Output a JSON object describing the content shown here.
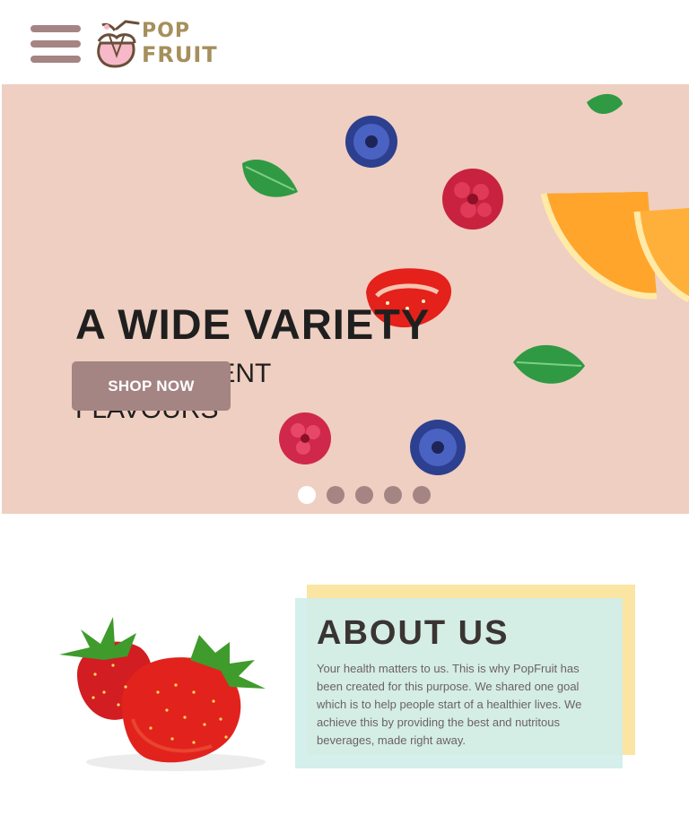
{
  "header": {
    "menu_icon": "hamburger-menu-icon",
    "logo": {
      "line1": "POP",
      "line2": "FRUIT",
      "icon": "apple-cup-logo-icon"
    }
  },
  "hero": {
    "title": "A WIDE VARIETY",
    "subtitle": "OF DIFFERENT\nFLAVOURS",
    "button_label": "SHOP NOW",
    "slides": 5,
    "active_slide": 1
  },
  "about": {
    "title": "ABOUT US",
    "body": "Your health matters to us. This is why PopFruit has been created for this purpose. We shared one goal which is to help people start of a healthier lives. We achieve this by providing the best and nutritous beverages, made right away."
  },
  "colors": {
    "accent": "#a58484",
    "hero_bg": "#efcfc1",
    "about_yellow": "#fbe5a3",
    "about_green": "#d0eeea",
    "logo": "#a58f5c"
  }
}
